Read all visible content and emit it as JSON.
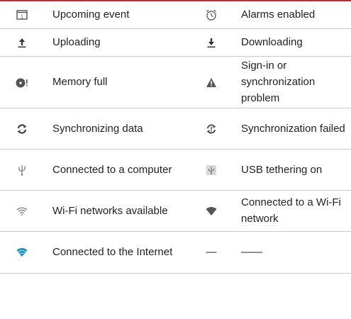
{
  "table": {
    "accent_color": "#b3333a",
    "rows": [
      {
        "left": {
          "icon": "calendar-icon",
          "label": "Upcoming event",
          "icon_text": "1"
        },
        "right": {
          "icon": "alarm-clock-icon",
          "label": "Alarms enabled"
        }
      },
      {
        "left": {
          "icon": "upload-arrow-icon",
          "label": "Uploading"
        },
        "right": {
          "icon": "download-arrow-icon",
          "label": "Downloading"
        }
      },
      {
        "left": {
          "icon": "memory-full-icon",
          "label": "Memory full"
        },
        "right": {
          "icon": "warning-triangle-icon",
          "label": "Sign-in or synchronization problem"
        }
      },
      {
        "left": {
          "icon": "sync-icon",
          "label": "Synchronizing data"
        },
        "right": {
          "icon": "sync-failed-icon",
          "label": "Synchronization failed"
        }
      },
      {
        "left": {
          "icon": "usb-icon",
          "label": "Connected to a computer"
        },
        "right": {
          "icon": "usb-tethering-icon",
          "label": "USB tethering on"
        }
      },
      {
        "left": {
          "icon": "wifi-available-icon",
          "label": "Wi-Fi networks available"
        },
        "right": {
          "icon": "wifi-connected-icon",
          "label": "Connected to a Wi-Fi network"
        }
      },
      {
        "left": {
          "icon": "internet-connected-icon",
          "label": "Connected to the Internet"
        },
        "right": {
          "icon_text": "—",
          "label": "——"
        }
      }
    ]
  }
}
